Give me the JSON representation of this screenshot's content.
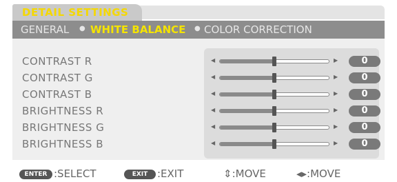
{
  "title": "DETAIL SETTINGS",
  "tabs": [
    {
      "label": "GENERAL"
    },
    {
      "label": "WHITE BALANCE"
    },
    {
      "label": "COLOR CORRECTION"
    }
  ],
  "tab_separator": "●",
  "active_tab_index": 1,
  "rows": [
    {
      "label": "CONTRAST R",
      "value": "0",
      "level": 0.5
    },
    {
      "label": "CONTRAST G",
      "value": "0",
      "level": 0.5
    },
    {
      "label": "CONTRAST B",
      "value": "0",
      "level": 0.5
    },
    {
      "label": "BRIGHTNESS R",
      "value": "0",
      "level": 0.5
    },
    {
      "label": "BRIGHTNESS G",
      "value": "0",
      "level": 0.5
    },
    {
      "label": "BRIGHTNESS B",
      "value": "0",
      "level": 0.5
    }
  ],
  "arrow_left": "◀",
  "arrow_right": "▶",
  "footer": {
    "enter_key": "ENTER",
    "enter_hint": ":SELECT",
    "exit_key": "EXIT",
    "exit_hint": ":EXIT",
    "move_vertical": "⇕:MOVE",
    "move_horizontal": "◂▸:MOVE"
  },
  "colors": {
    "title": "#f5d800",
    "active_tab": "#f5e400",
    "tab_bar": "#8d8d8d",
    "value_pill": "#7a7a7a"
  }
}
